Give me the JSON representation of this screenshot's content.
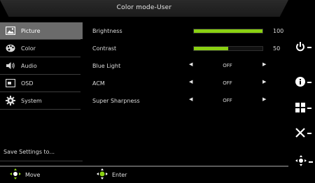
{
  "header": {
    "title": "Color mode-User"
  },
  "sidebar": {
    "items": [
      {
        "label": "Picture",
        "icon": "picture-icon",
        "active": true
      },
      {
        "label": "Color",
        "icon": "palette-icon",
        "active": false
      },
      {
        "label": "Audio",
        "icon": "speaker-icon",
        "active": false
      },
      {
        "label": "OSD",
        "icon": "osd-icon",
        "active": false
      },
      {
        "label": "System",
        "icon": "gear-icon",
        "active": false
      }
    ],
    "save_label": "Save Settings to..."
  },
  "settings": [
    {
      "label": "Brightness",
      "type": "slider",
      "value": 100,
      "max": 100,
      "display": "100"
    },
    {
      "label": "Contrast",
      "type": "slider",
      "value": 50,
      "max": 100,
      "display": "50"
    },
    {
      "label": "Blue Light",
      "type": "select",
      "value": "OFF"
    },
    {
      "label": "ACM",
      "type": "select",
      "value": "OFF"
    },
    {
      "label": "Super Sharpness",
      "type": "select",
      "value": "OFF"
    }
  ],
  "footer": {
    "move_label": "Move",
    "enter_label": "Enter"
  },
  "hardware_keys": [
    "power-icon",
    "info-icon",
    "grid-icon",
    "close-icon",
    "navigate-icon"
  ],
  "colors": {
    "accent": "#8ad012",
    "active_bg": "#6b6b6b",
    "background": "#000000"
  }
}
